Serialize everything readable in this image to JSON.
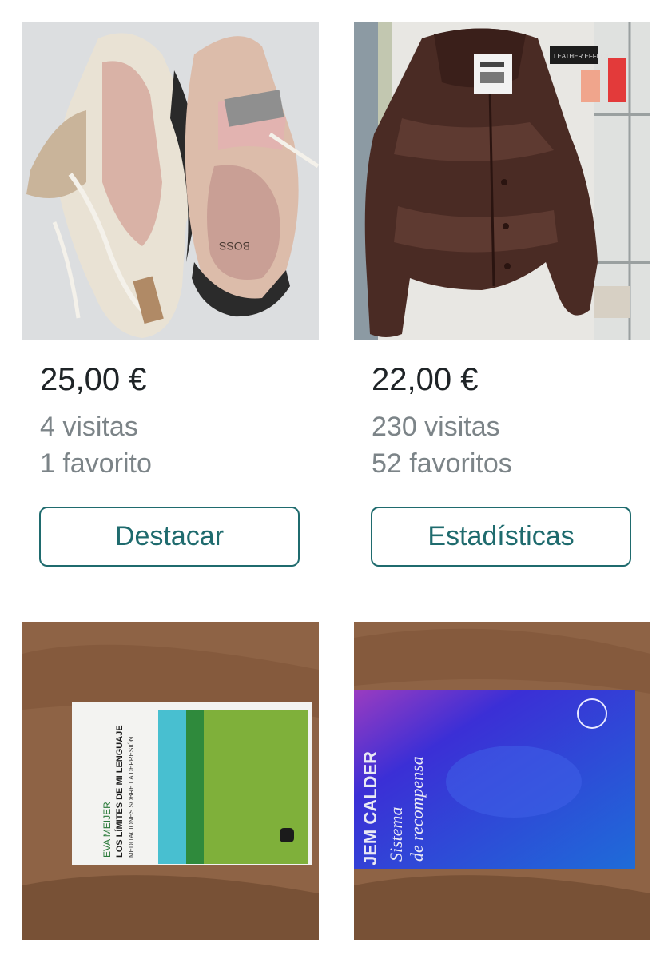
{
  "items": [
    {
      "image_icon": "sneakers-photo",
      "price": "25,00 €",
      "visits": "4 visitas",
      "favorites": "1 favorito",
      "action_label": "Destacar",
      "image_text": "BOSS"
    },
    {
      "image_icon": "leather-jacket-photo",
      "price": "22,00 €",
      "visits": "230 visitas",
      "favorites": "52 favoritos",
      "action_label": "Estadísticas",
      "image_text": "LEATHER EFFECT"
    },
    {
      "image_icon": "book-photo",
      "book_author": "EVA MEIJER",
      "book_title": "LOS LÍMITES DE MI LENGUAJE",
      "book_subtitle": "MEDITACIONES SOBRE LA DEPRESIÓN"
    },
    {
      "image_icon": "book-photo",
      "book_author": "JEM CALDER",
      "book_title_line1": "Sistema",
      "book_title_line2": "de recompensa"
    }
  ]
}
